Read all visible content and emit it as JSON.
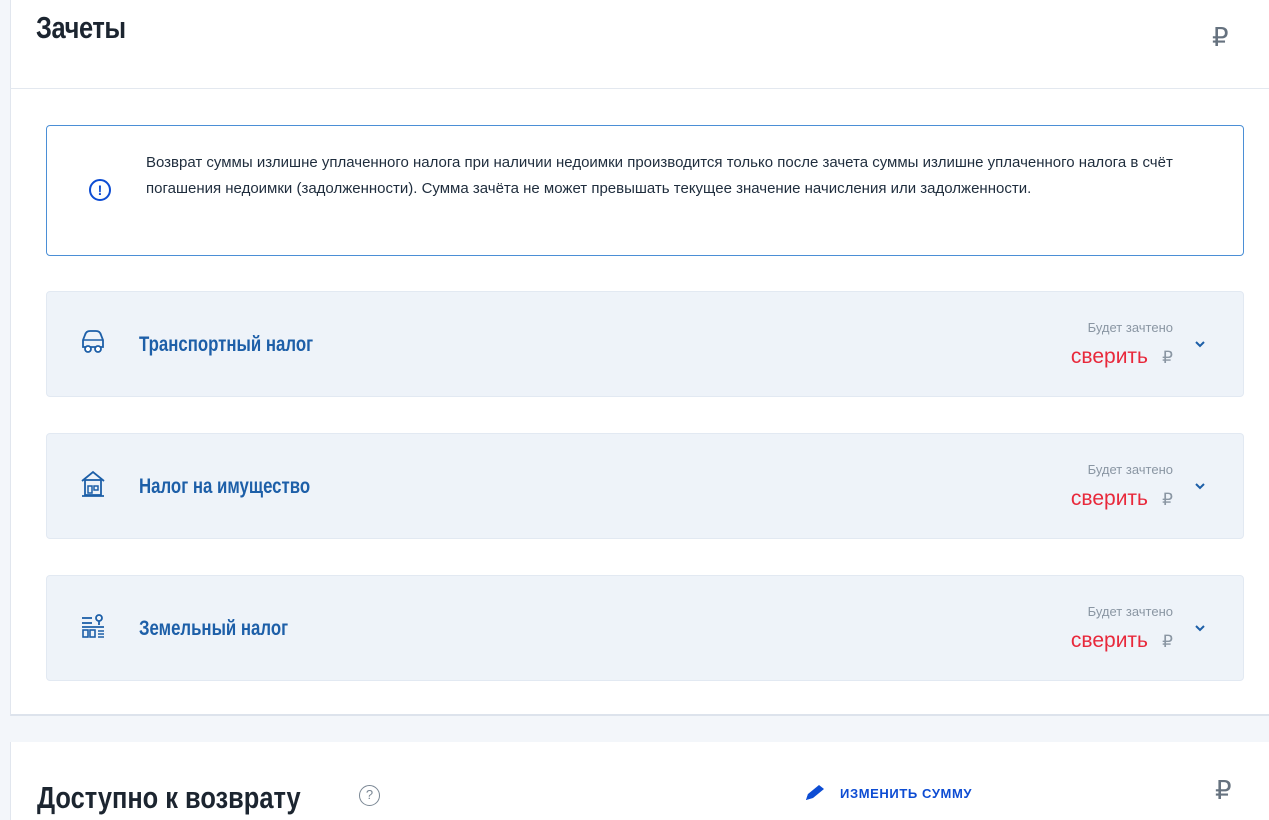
{
  "offsets": {
    "title": "Зачеты",
    "currency": "₽",
    "notice": "Возврат суммы излишне уплаченного налога при наличии недоимки производится только после зачета суммы излишне уплаченного налога в счёт погашения недоимки (задолженности). Сумма зачёта не может превышать текущее значение начисления или задолженности.",
    "notice_icon": "!",
    "taxes": [
      {
        "name": "Транспортный налог",
        "icon": "car-icon",
        "status_label": "Будет зачтено",
        "value": "сверить",
        "currency": "₽"
      },
      {
        "name": "Налог на имущество",
        "icon": "house-icon",
        "status_label": "Будет зачтено",
        "value": "сверить",
        "currency": "₽"
      },
      {
        "name": "Земельный налог",
        "icon": "land-plot-icon",
        "status_label": "Будет зачтено",
        "value": "сверить",
        "currency": "₽"
      }
    ]
  },
  "refund": {
    "title": "Доступно к возврату",
    "help_icon": "?",
    "change_amount_label": "ИЗМЕНИТЬ СУММУ",
    "currency": "₽"
  },
  "colors": {
    "accent": "#0d4cd3",
    "tax_name": "#1d5fa8",
    "value_red": "#e8283b",
    "row_bg": "#eef3f9"
  }
}
